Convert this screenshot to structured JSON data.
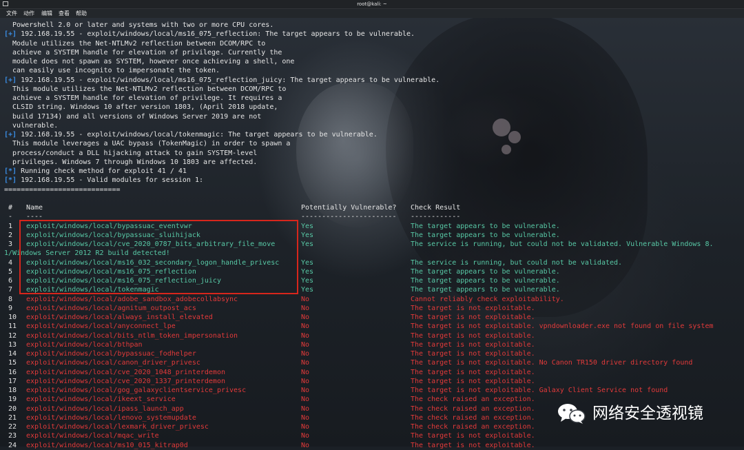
{
  "window": {
    "title": "root@kali: ~"
  },
  "menu": [
    "文件",
    "动作",
    "编辑",
    "查看",
    "帮助"
  ],
  "output_lines": [
    {
      "prefix": "",
      "text": "  Powershell 2.0 or later and systems with two or more CPU cores."
    },
    {
      "prefix": "[+]",
      "text": " 192.168.19.55 - exploit/windows/local/ms16_075_reflection: The target appears to be vulnerable."
    },
    {
      "prefix": "",
      "text": "  Module utilizes the Net-NTLMv2 reflection between DCOM/RPC to"
    },
    {
      "prefix": "",
      "text": "  achieve a SYSTEM handle for elevation of privilege. Currently the"
    },
    {
      "prefix": "",
      "text": "  module does not spawn as SYSTEM, however once achieving a shell, one"
    },
    {
      "prefix": "",
      "text": "  can easily use incognito to impersonate the token."
    },
    {
      "prefix": "[+]",
      "text": " 192.168.19.55 - exploit/windows/local/ms16_075_reflection_juicy: The target appears to be vulnerable."
    },
    {
      "prefix": "",
      "text": "  This module utilizes the Net-NTLMv2 reflection between DCOM/RPC to"
    },
    {
      "prefix": "",
      "text": "  achieve a SYSTEM handle for elevation of privilege. It requires a"
    },
    {
      "prefix": "",
      "text": "  CLSID string. Windows 10 after version 1803, (April 2018 update,"
    },
    {
      "prefix": "",
      "text": "  build 17134) and all versions of Windows Server 2019 are not"
    },
    {
      "prefix": "",
      "text": "  vulnerable."
    },
    {
      "prefix": "[+]",
      "text": " 192.168.19.55 - exploit/windows/local/tokenmagic: The target appears to be vulnerable."
    },
    {
      "prefix": "",
      "text": "  This module leverages a UAC bypass (TokenMagic) in order to spawn a"
    },
    {
      "prefix": "",
      "text": "  process/conduct a DLL hijacking attack to gain SYSTEM-level"
    },
    {
      "prefix": "",
      "text": "  privileges. Windows 7 through Windows 10 1803 are affected."
    },
    {
      "prefix": "[*]",
      "text": " Running check method for exploit 41 / 41"
    },
    {
      "prefix": "[*]",
      "text": " 192.168.19.55 - Valid modules for session 1:"
    },
    {
      "prefix": "",
      "text": "============================"
    }
  ],
  "table": {
    "headers": {
      "num": "#",
      "name": "Name",
      "vuln": "Potentially Vulnerable?",
      "result": "Check Result"
    },
    "underline": {
      "num": "-",
      "name": "----",
      "vuln": "-----------------------",
      "result": "------------"
    },
    "rows": [
      {
        "num": "1",
        "name": "exploit/windows/local/bypassuac_eventvwr",
        "vuln": "Yes",
        "result": "The target appears to be vulnerable.",
        "status": "yes"
      },
      {
        "num": "2",
        "name": "exploit/windows/local/bypassuac_sluihijack",
        "vuln": "Yes",
        "result": "The target appears to be vulnerable.",
        "status": "yes"
      },
      {
        "num": "3",
        "name": "exploit/windows/local/cve_2020_0787_bits_arbitrary_file_move",
        "vuln": "Yes",
        "result": "The service is running, but could not be validated. Vulnerable Windows 8.",
        "status": "yes",
        "wrap": "1/Windows Server 2012 R2 build detected!"
      },
      {
        "num": "4",
        "name": "exploit/windows/local/ms16_032_secondary_logon_handle_privesc",
        "vuln": "Yes",
        "result": "The service is running, but could not be validated.",
        "status": "yes"
      },
      {
        "num": "5",
        "name": "exploit/windows/local/ms16_075_reflection",
        "vuln": "Yes",
        "result": "The target appears to be vulnerable.",
        "status": "yes"
      },
      {
        "num": "6",
        "name": "exploit/windows/local/ms16_075_reflection_juicy",
        "vuln": "Yes",
        "result": "The target appears to be vulnerable.",
        "status": "yes"
      },
      {
        "num": "7",
        "name": "exploit/windows/local/tokenmagic",
        "vuln": "Yes",
        "result": "The target appears to be vulnerable.",
        "status": "yes"
      },
      {
        "num": "8",
        "name": "exploit/windows/local/adobe_sandbox_adobecollabsync",
        "vuln": "No",
        "result": "Cannot reliably check exploitability.",
        "status": "no"
      },
      {
        "num": "9",
        "name": "exploit/windows/local/agnitum_outpost_acs",
        "vuln": "No",
        "result": "The target is not exploitable.",
        "status": "no"
      },
      {
        "num": "10",
        "name": "exploit/windows/local/always_install_elevated",
        "vuln": "No",
        "result": "The target is not exploitable.",
        "status": "no"
      },
      {
        "num": "11",
        "name": "exploit/windows/local/anyconnect_lpe",
        "vuln": "No",
        "result": "The target is not exploitable. vpndownloader.exe not found on file system",
        "status": "no"
      },
      {
        "num": "12",
        "name": "exploit/windows/local/bits_ntlm_token_impersonation",
        "vuln": "No",
        "result": "The target is not exploitable.",
        "status": "no"
      },
      {
        "num": "13",
        "name": "exploit/windows/local/bthpan",
        "vuln": "No",
        "result": "The target is not exploitable.",
        "status": "no"
      },
      {
        "num": "14",
        "name": "exploit/windows/local/bypassuac_fodhelper",
        "vuln": "No",
        "result": "The target is not exploitable.",
        "status": "no"
      },
      {
        "num": "15",
        "name": "exploit/windows/local/canon_driver_privesc",
        "vuln": "No",
        "result": "The target is not exploitable. No Canon TR150 driver directory found",
        "status": "no"
      },
      {
        "num": "16",
        "name": "exploit/windows/local/cve_2020_1048_printerdemon",
        "vuln": "No",
        "result": "The target is not exploitable.",
        "status": "no"
      },
      {
        "num": "17",
        "name": "exploit/windows/local/cve_2020_1337_printerdemon",
        "vuln": "No",
        "result": "The target is not exploitable.",
        "status": "no"
      },
      {
        "num": "18",
        "name": "exploit/windows/local/gog_galaxyclientservice_privesc",
        "vuln": "No",
        "result": "The target is not exploitable. Galaxy Client Service not found",
        "status": "no"
      },
      {
        "num": "19",
        "name": "exploit/windows/local/ikeext_service",
        "vuln": "No",
        "result": "The check raised an exception.",
        "status": "no"
      },
      {
        "num": "20",
        "name": "exploit/windows/local/ipass_launch_app",
        "vuln": "No",
        "result": "The check raised an exception.",
        "status": "no"
      },
      {
        "num": "21",
        "name": "exploit/windows/local/lenovo_systemupdate",
        "vuln": "No",
        "result": "The check raised an exception.",
        "status": "no"
      },
      {
        "num": "22",
        "name": "exploit/windows/local/lexmark_driver_privesc",
        "vuln": "No",
        "result": "The check raised an exception.",
        "status": "no"
      },
      {
        "num": "23",
        "name": "exploit/windows/local/mqac_write",
        "vuln": "No",
        "result": "The target is not exploitable.",
        "status": "no"
      },
      {
        "num": "24",
        "name": "exploit/windows/local/ms10_015_kitrap0d",
        "vuln": "No",
        "result": "The target is not exploitable.",
        "status": "no"
      }
    ]
  },
  "watermark": {
    "text": "网络安全透视镜",
    "icon": "wechat-icon"
  },
  "colors": {
    "vulnerable": "#58c9a6",
    "not_vulnerable": "#e33a3a",
    "prefix": "#3a8ee6",
    "highlight_box": "#d8261c"
  }
}
